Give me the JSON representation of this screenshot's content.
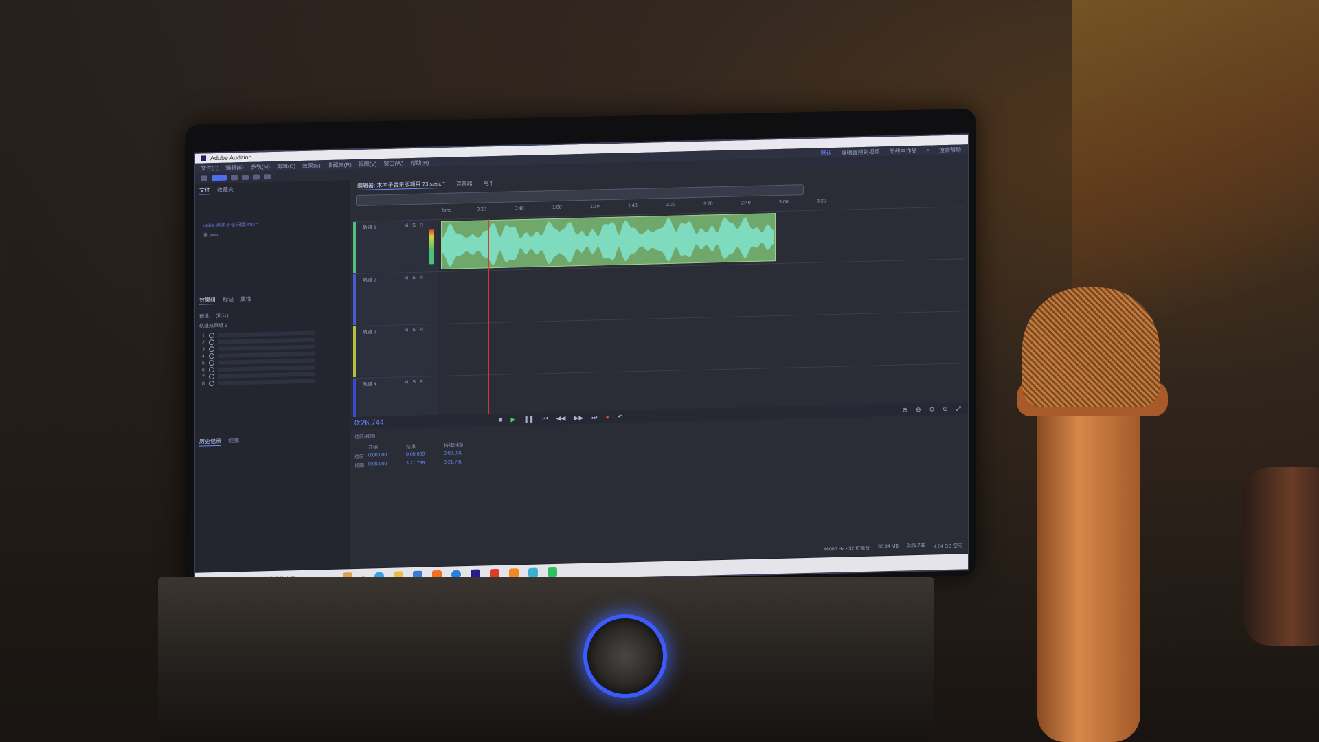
{
  "window": {
    "title": "Adobe Audition"
  },
  "menu": {
    "items": [
      "文件(F)",
      "编辑(E)",
      "多轨(M)",
      "剪辑(C)",
      "效果(S)",
      "收藏夹(R)",
      "视图(V)",
      "窗口(W)",
      "帮助(H)"
    ],
    "workspaces": [
      "默认",
      "编辑音频到视频",
      "无线电作品"
    ],
    "search_label": "搜索帮助"
  },
  "left_panel": {
    "tabs": [
      "文件",
      "收藏夹"
    ],
    "files": [
      "unkio 木木子音乐版.wav *",
      "录.wav"
    ],
    "effects_tabs": [
      "效果组",
      "标记",
      "属性"
    ],
    "preset_label": "预设:",
    "preset_value": "(默认)",
    "effects_group_label": "轨道效果组 1",
    "slots": [
      "1",
      "2",
      "3",
      "4",
      "5",
      "6",
      "7",
      "8"
    ]
  },
  "history": {
    "tabs": [
      "历史记录",
      "视频"
    ]
  },
  "editor": {
    "tabs": [
      "编辑器: 木木子音乐版项目 73.sesx *",
      "混音器",
      "电平"
    ],
    "ruler_ticks": [
      "hms",
      "0:20",
      "0:40",
      "1:00",
      "1:20",
      "1:40",
      "2:00",
      "2:20",
      "2:40",
      "3:00",
      "3:20"
    ],
    "tracks": [
      {
        "name": "轨道 1",
        "color": "#4ec07a"
      },
      {
        "name": "轨道 2",
        "color": "#4a5ad0"
      },
      {
        "name": "轨道 3",
        "color": "#b8c23a"
      },
      {
        "name": "轨道 4",
        "color": "#3a4ad0"
      }
    ],
    "msr": [
      "M",
      "S",
      "R"
    ],
    "current_time": "0:26.744"
  },
  "selection": {
    "title": "选区/视图",
    "headers": [
      "开始",
      "结束",
      "持续时间"
    ],
    "rows": [
      {
        "label": "选区",
        "start": "0:00.000",
        "end": "0:00.000",
        "dur": "0:00.000"
      },
      {
        "label": "视图",
        "start": "0:00.000",
        "end": "3:21.739",
        "dur": "3:21.739"
      }
    ]
  },
  "status": {
    "format": "48000 Hz • 32 位混合",
    "memory": "36.94 MB",
    "duration": "3:21.739",
    "free": "4.04 GB 空闲"
  },
  "taskbar": {
    "search_placeholder": "在这里输入你要搜索的内容"
  },
  "colors": {
    "accent": "#6a8cff",
    "clip": "#6fa86a",
    "playhead": "#d23a2a",
    "speaker_glow": "#3b5bff"
  }
}
